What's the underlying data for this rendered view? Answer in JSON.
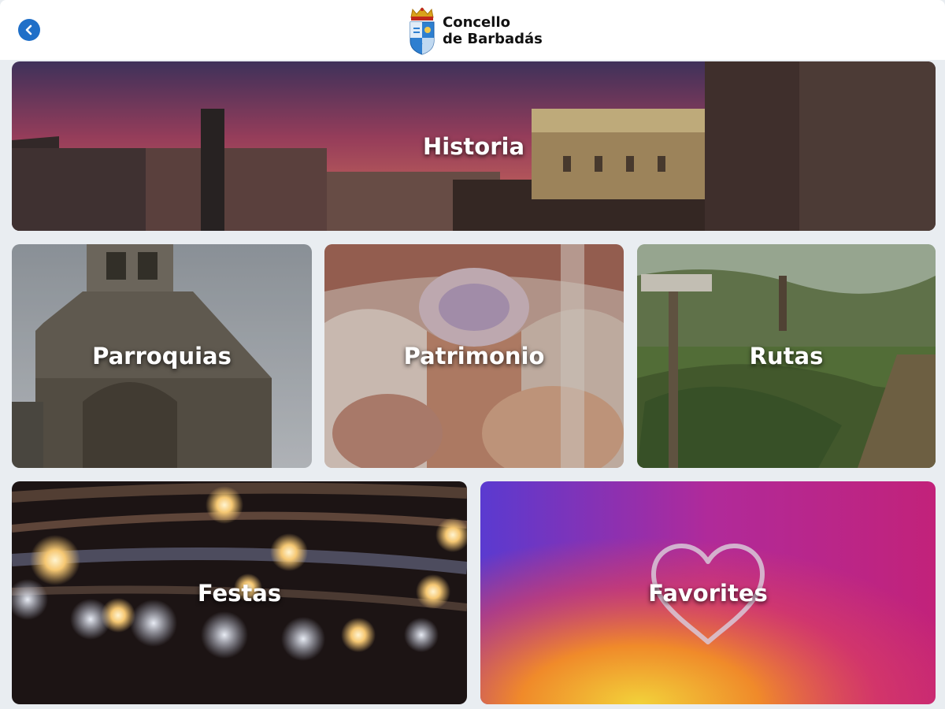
{
  "header": {
    "back_icon": "chevron-left-icon",
    "logo_line1": "Concello",
    "logo_line2": "de Barbadás",
    "accent": "#1f6fc8"
  },
  "tiles": [
    {
      "label": "Historia"
    },
    {
      "label": "Parroquias"
    },
    {
      "label": "Patrimonio"
    },
    {
      "label": "Rutas"
    },
    {
      "label": "Festas"
    },
    {
      "label": "Favorites",
      "icon": "heart-icon"
    }
  ]
}
